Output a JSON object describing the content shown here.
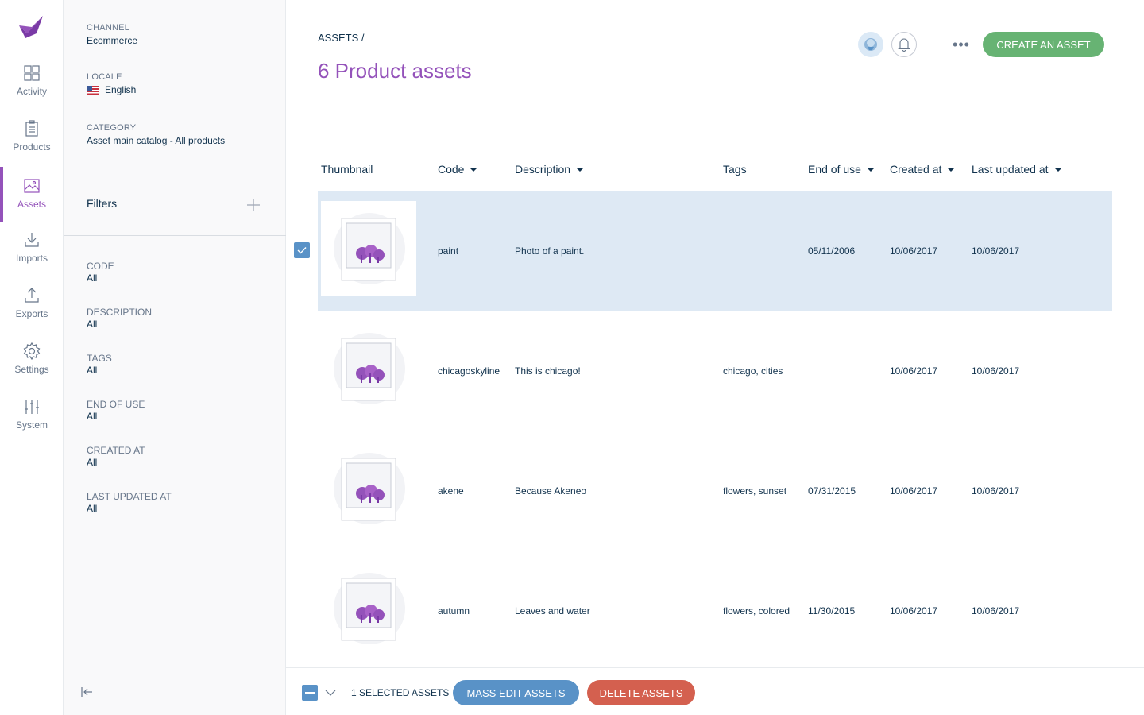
{
  "nav": {
    "logo": "akeneo-logo",
    "items": [
      {
        "label": "Activity",
        "icon": "activity-icon"
      },
      {
        "label": "Products",
        "icon": "products-icon"
      },
      {
        "label": "Assets",
        "icon": "assets-icon",
        "active": true
      },
      {
        "label": "Imports",
        "icon": "imports-icon"
      },
      {
        "label": "Exports",
        "icon": "exports-icon"
      },
      {
        "label": "Settings",
        "icon": "settings-icon"
      },
      {
        "label": "System",
        "icon": "system-icon"
      }
    ]
  },
  "panel": {
    "channel": {
      "label": "CHANNEL",
      "value": "Ecommerce"
    },
    "locale": {
      "label": "LOCALE",
      "value": "English",
      "flag": "us-flag-icon"
    },
    "category": {
      "label": "CATEGORY",
      "value": "Asset main catalog - All products"
    },
    "filters_title": "Filters",
    "filters": [
      {
        "label": "CODE",
        "value": "All"
      },
      {
        "label": "DESCRIPTION",
        "value": "All"
      },
      {
        "label": "TAGS",
        "value": "All"
      },
      {
        "label": "END OF USE",
        "value": "All"
      },
      {
        "label": "CREATED AT",
        "value": "All"
      },
      {
        "label": "LAST UPDATED AT",
        "value": "All"
      }
    ]
  },
  "header": {
    "breadcrumb": "ASSETS /",
    "title": "6 Product assets",
    "more": "•••",
    "create_label": "CREATE AN ASSET"
  },
  "table": {
    "columns": {
      "thumbnail": "Thumbnail",
      "code": "Code",
      "description": "Description",
      "tags": "Tags",
      "end_of_use": "End of use",
      "created_at": "Created at",
      "last_updated_at": "Last updated at"
    },
    "rows": [
      {
        "code": "paint",
        "description": "Photo of a paint.",
        "tags": "",
        "end_of_use": "05/11/2006",
        "created_at": "10/06/2017",
        "last_updated_at": "10/06/2017",
        "selected": true
      },
      {
        "code": "chicagoskyline",
        "description": "This is chicago!",
        "tags": "chicago, cities",
        "end_of_use": "",
        "created_at": "10/06/2017",
        "last_updated_at": "10/06/2017",
        "selected": false
      },
      {
        "code": "akene",
        "description": "Because Akeneo",
        "tags": "flowers, sunset",
        "end_of_use": "07/31/2015",
        "created_at": "10/06/2017",
        "last_updated_at": "10/06/2017",
        "selected": false
      },
      {
        "code": "autumn",
        "description": "Leaves and water",
        "tags": "flowers, colored",
        "end_of_use": "11/30/2015",
        "created_at": "10/06/2017",
        "last_updated_at": "10/06/2017",
        "selected": false
      }
    ]
  },
  "footer": {
    "selected_count": "1 SELECTED ASSETS",
    "mass_edit_label": "MASS EDIT ASSETS",
    "delete_label": "DELETE ASSETS"
  },
  "colors": {
    "brand_purple": "#9452ba",
    "primary_green": "#67b373",
    "selection_blue": "#5992c7",
    "danger_red": "#d4604f",
    "selected_row": "#dee9f4"
  }
}
